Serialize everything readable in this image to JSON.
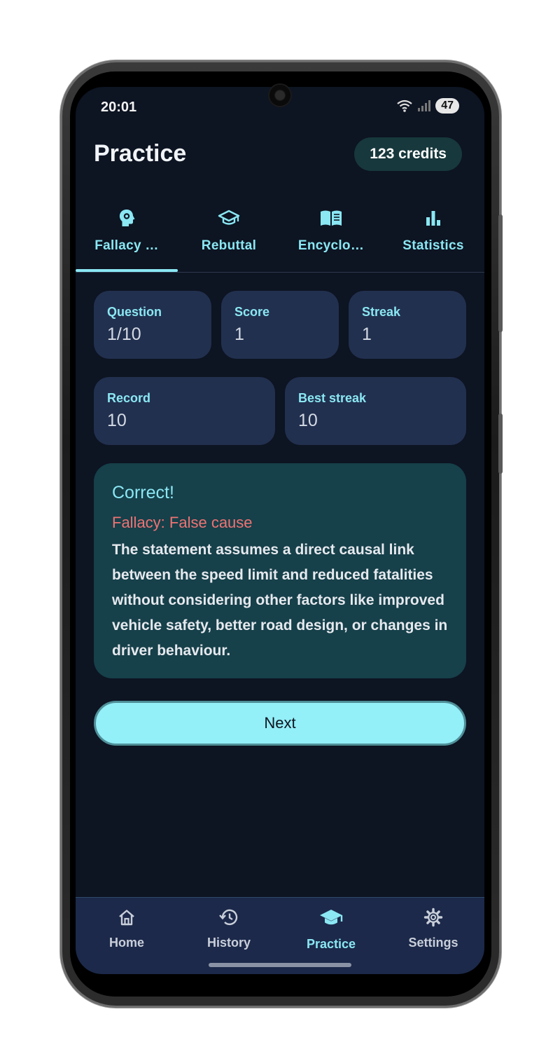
{
  "status_bar": {
    "time": "20:01",
    "battery": "47"
  },
  "header": {
    "title": "Practice",
    "credits": "123 credits"
  },
  "tabs": [
    {
      "label": "Fallacy …",
      "icon": "brain-head-icon",
      "active": true
    },
    {
      "label": "Rebuttal",
      "icon": "graduation-cap-icon",
      "active": false
    },
    {
      "label": "Encyclo…",
      "icon": "open-book-icon",
      "active": false
    },
    {
      "label": "Statistics",
      "icon": "bar-chart-icon",
      "active": false
    }
  ],
  "stats": {
    "question": {
      "label": "Question",
      "value": "1/10"
    },
    "score": {
      "label": "Score",
      "value": "1"
    },
    "streak": {
      "label": "Streak",
      "value": "1"
    },
    "record": {
      "label": "Record",
      "value": "10"
    },
    "best_streak": {
      "label": "Best streak",
      "value": "10"
    }
  },
  "feedback": {
    "result": "Correct!",
    "fallacy": "Fallacy: False cause",
    "explanation": "The statement assumes a direct causal link between the speed limit and reduced fatalities without considering other factors like improved vehicle safety, better road design, or changes in driver behaviour."
  },
  "next_button": "Next",
  "bottom_nav": [
    {
      "label": "Home",
      "icon": "home-icon",
      "active": false
    },
    {
      "label": "History",
      "icon": "history-icon",
      "active": false
    },
    {
      "label": "Practice",
      "icon": "graduation-cap-icon",
      "active": true
    },
    {
      "label": "Settings",
      "icon": "gear-icon",
      "active": false
    }
  ],
  "colors": {
    "background": "#0d1422",
    "accent": "#8ae7f3",
    "card": "#22304f",
    "feedback_card": "#16404a",
    "error": "#ef7373",
    "button": "#93eff8"
  }
}
